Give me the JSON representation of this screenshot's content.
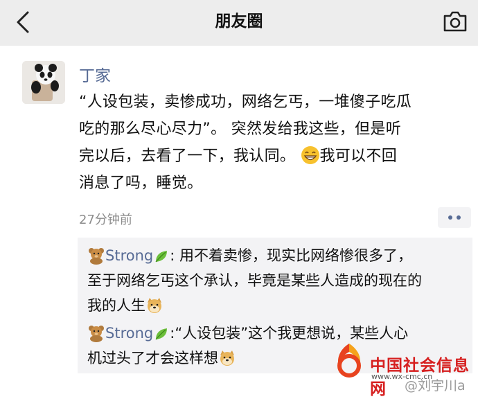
{
  "header": {
    "title": "朋友圈",
    "back_icon": "chevron-left-icon",
    "camera_icon": "camera-icon",
    "background": "#ededed"
  },
  "post": {
    "author": "丁家",
    "text_line1": "“人设包装，卖惨成功，网络乞丐，一堆傻子吃瓜",
    "text_line2": "吃的那么尽心尽力”。 突然发给我这些，但是听",
    "text_line3_a": "完以后，去看了一下，我认同。 ",
    "text_line3_b": "我可以不回",
    "text_line4": "消息了吗，睡觉。",
    "time": "27分钟前",
    "more_icon": "more-dots-icon",
    "name_color": "#576b95"
  },
  "comments": [
    {
      "name": "Strong",
      "sep": ":",
      "text_line1": " 用不着卖惨，现实比网络惨很多了，",
      "text_line2": "至于网络乞丐这个承认，毕竟是某些人造成的现在的",
      "text_line3": "我的人生"
    },
    {
      "name": "Strong",
      "sep": ":",
      "text_line1": "“人设包装”这个我更想说，某些人心",
      "text_line2": "机过头了才会这样想"
    }
  ],
  "watermark": {
    "site": "中国社会信息网",
    "url": "www.wx-cmc.cn",
    "weibo": "@刘宇川a"
  }
}
